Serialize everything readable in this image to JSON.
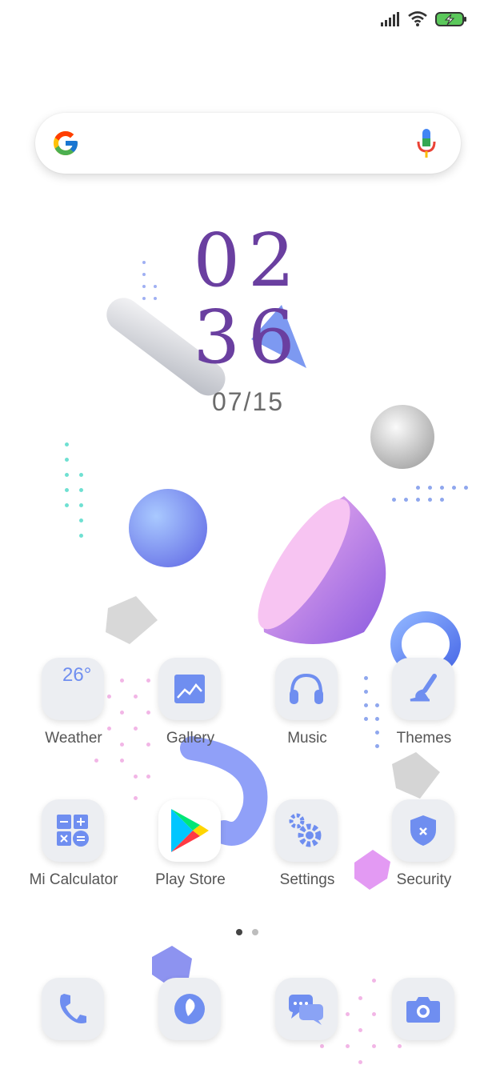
{
  "status_bar": {
    "signal": "signal-icon",
    "wifi": "wifi-icon",
    "battery": "battery-charging-icon"
  },
  "search": {
    "logo": "google-icon",
    "mic": "mic-icon"
  },
  "clock": {
    "hour": "02",
    "minute": "36",
    "date": "07/15"
  },
  "apps_row1": [
    {
      "label": "Weather",
      "icon": "weather-icon",
      "temp": "26°"
    },
    {
      "label": "Gallery",
      "icon": "gallery-icon"
    },
    {
      "label": "Music",
      "icon": "headphones-icon"
    },
    {
      "label": "Themes",
      "icon": "brush-icon"
    }
  ],
  "apps_row2": [
    {
      "label": "Mi Calculator",
      "icon": "calculator-icon"
    },
    {
      "label": "Play Store",
      "icon": "play-store-icon"
    },
    {
      "label": "Settings",
      "icon": "gear-icon"
    },
    {
      "label": "Security",
      "icon": "shield-icon"
    }
  ],
  "dock": [
    {
      "icon": "phone-icon"
    },
    {
      "icon": "browser-icon"
    },
    {
      "icon": "messages-icon"
    },
    {
      "icon": "camera-icon"
    }
  ],
  "pager": {
    "pages": 2,
    "current": 1
  },
  "colors": {
    "clock": "#6a3fa0",
    "icon_accent": "#6f8ef0",
    "icon_bg": "#eceef2"
  }
}
